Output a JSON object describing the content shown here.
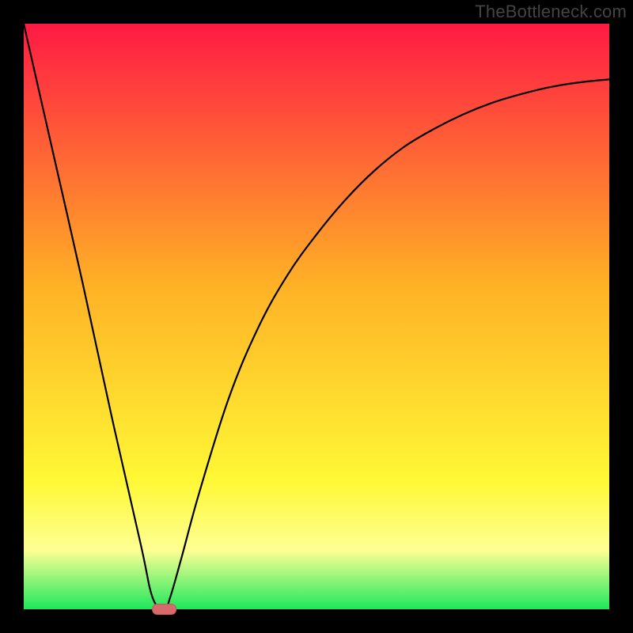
{
  "watermark": "TheBottleneck.com",
  "colors": {
    "frame": "#000000",
    "curve": "#000000",
    "gradient_top": "#ff1a44",
    "gradient_mid": "#ffb226",
    "gradient_low": "#fff835",
    "gradient_band": "#fdff94",
    "gradient_bottom": "#1ee85c",
    "marker_fill": "#d76b6b",
    "marker_stroke": "#c95858"
  },
  "chart_data": {
    "type": "line",
    "title": "",
    "xlabel": "",
    "ylabel": "",
    "xlim": [
      0,
      100
    ],
    "ylim": [
      0,
      100
    ],
    "grid": false,
    "legend": false,
    "series": [
      {
        "name": "bottleneck-curve",
        "x": [
          0,
          5,
          10,
          15,
          20,
          22,
          24,
          25,
          27,
          30,
          35,
          40,
          45,
          50,
          55,
          60,
          65,
          70,
          75,
          80,
          85,
          90,
          95,
          100
        ],
        "y": [
          100,
          78,
          56,
          33,
          11,
          2,
          0,
          2,
          9,
          20,
          36,
          48,
          57,
          64,
          70,
          75,
          79,
          82,
          84.5,
          86.5,
          88,
          89.2,
          90,
          90.5
        ]
      }
    ],
    "marker": {
      "x": 24,
      "y": 0,
      "label": "optimal-point"
    }
  }
}
